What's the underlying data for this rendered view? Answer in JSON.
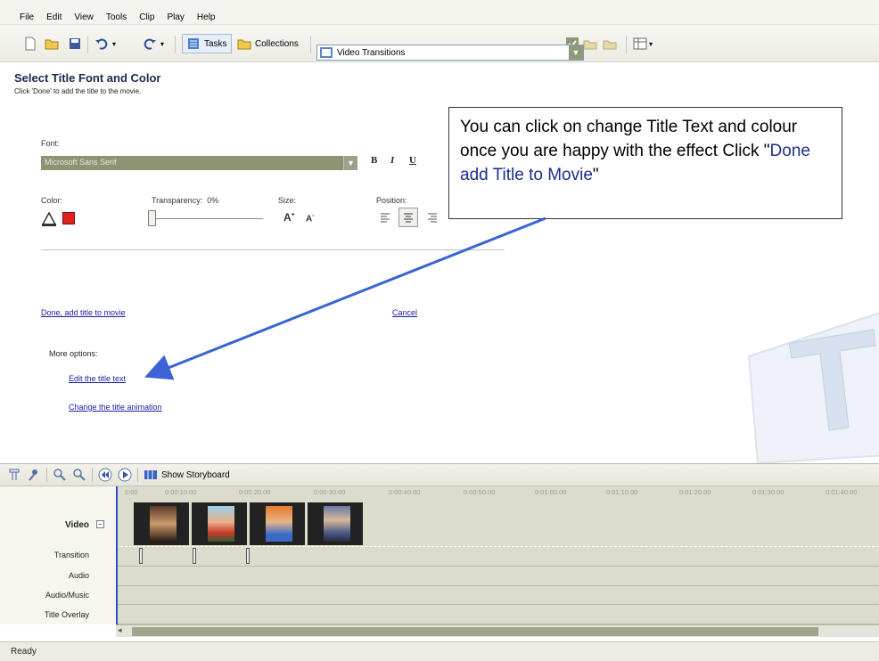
{
  "menu": [
    "File",
    "Edit",
    "View",
    "Tools",
    "Clip",
    "Play",
    "Help"
  ],
  "toolbar": {
    "tasks_label": "Tasks",
    "collections_label": "Collections",
    "collection_value": "Video Transitions"
  },
  "pane": {
    "title": "Select Title Font and Color",
    "subtitle": "Click 'Done' to add the title to the movie.",
    "font_label": "Font:",
    "font_value": "Microsoft Sans Serif",
    "bold": "B",
    "italic": "I",
    "underline": "U",
    "color_label": "Color:",
    "transparency_label": "Transparency:",
    "transparency_value": "0%",
    "transparency_level": 0,
    "size_label": "Size:",
    "position_label": "Position:",
    "done_link": "Done, add title to movie",
    "cancel_link": "Cancel",
    "more_options": "More options:",
    "edit_link": "Edit the title text",
    "animation_link": "Change the title animation"
  },
  "callout": {
    "text_before": "You can click on change Title Text and colour once you are happy with the effect Click \"",
    "text_blue": "Done add Title to Movie",
    "text_after": "\""
  },
  "timeline": {
    "storyboard_label": "Show Storyboard",
    "ruler": [
      "0:00",
      "0:00:10.00",
      "0:00:20.00",
      "0:00:30.00",
      "0:00:40.00",
      "0:00:50.00",
      "0:01:00.00",
      "0:01:10.00",
      "0:01:20.00",
      "0:01:30.00",
      "0:01:40.00"
    ],
    "tracks": {
      "video": "Video",
      "transition": "Transition",
      "audio": "Audio",
      "audio_music": "Audio/Music",
      "title_overlay": "Title Overlay"
    }
  },
  "status": "Ready",
  "colors": {
    "accent": "#1a1aa6",
    "font_box": "#8c9471",
    "text_color": "#e0201c",
    "arrow": "#3a63d6"
  }
}
